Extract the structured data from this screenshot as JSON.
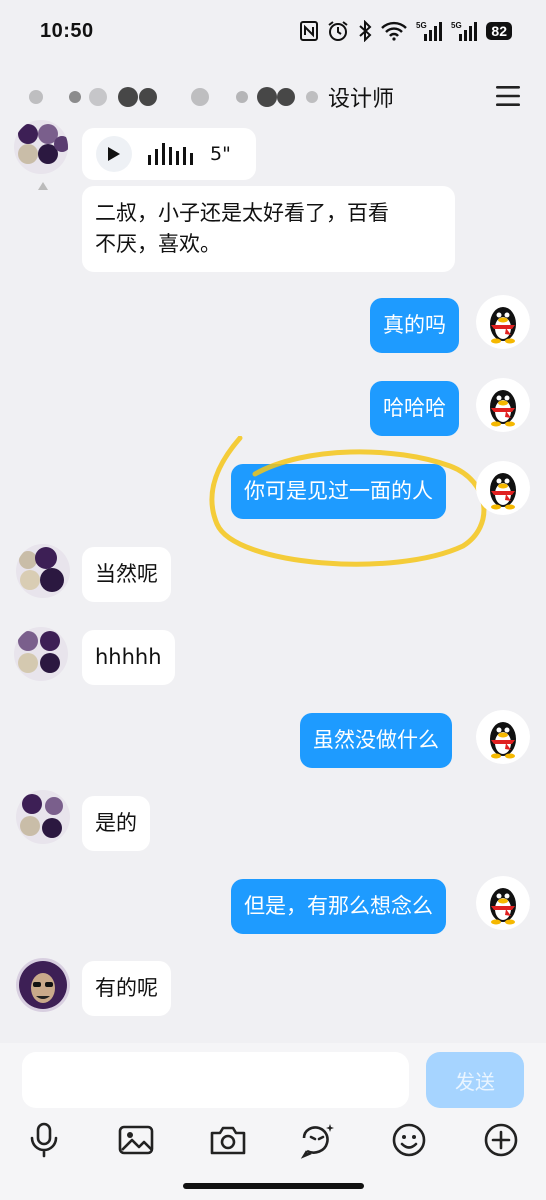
{
  "status_bar": {
    "time": "10:50",
    "battery": "82",
    "signal_label_1": "5G",
    "signal_label_2": "5G"
  },
  "header": {
    "title_visible": "设计师"
  },
  "messages": [
    {
      "side": "in",
      "type": "voice",
      "duration": "5\""
    },
    {
      "side": "in",
      "text": "二叔，小子还是太好看了，百看不厌，喜欢。"
    },
    {
      "side": "out",
      "text": "真的吗"
    },
    {
      "side": "out",
      "text": "哈哈哈"
    },
    {
      "side": "out",
      "text": "你可是见过一面的人",
      "highlighted": true
    },
    {
      "side": "in",
      "text": "当然呢"
    },
    {
      "side": "in",
      "text": "hhhhh"
    },
    {
      "side": "out",
      "text": "虽然没做什么"
    },
    {
      "side": "in",
      "text": "是的"
    },
    {
      "side": "out",
      "text": "但是，有那么想念么"
    },
    {
      "side": "in",
      "text": "有的呢"
    }
  ],
  "message_line_1": "二叔，小子还是太好看了，百看",
  "message_line_2": "不厌，喜欢。",
  "input": {
    "value": "",
    "send_label": "发送"
  },
  "toolbar": [
    "mic-icon",
    "image-icon",
    "camera-icon",
    "sticker-icon",
    "emoji-icon",
    "plus-icon"
  ],
  "colors": {
    "outgoing_bubble": "#1e9bff",
    "incoming_bubble": "#ffffff",
    "background": "#f0f0f3",
    "send_button": "#a6d4ff",
    "highlight_circle": "#f5c518"
  }
}
